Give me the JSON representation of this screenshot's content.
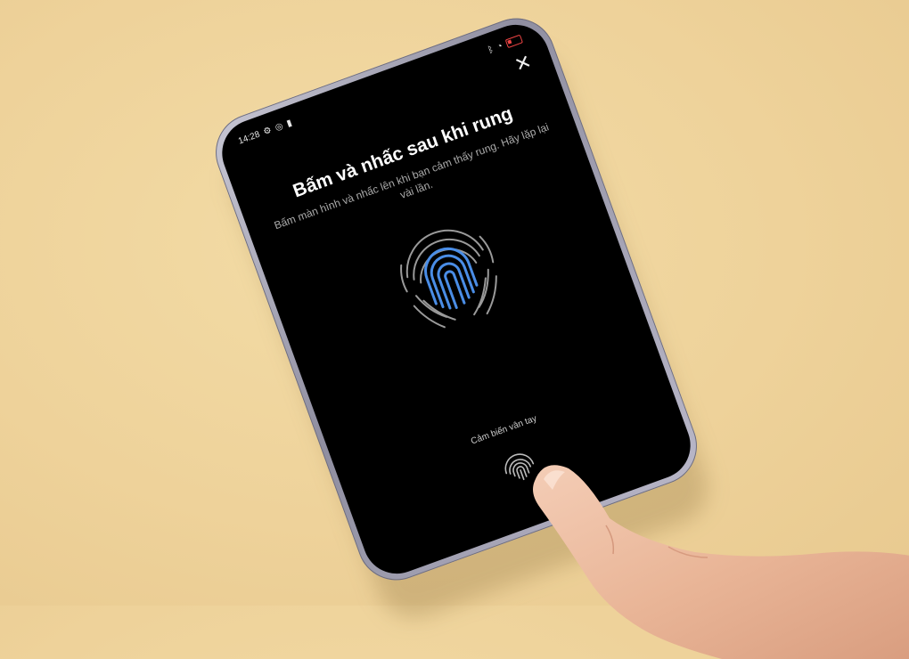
{
  "status_bar": {
    "time": "14:28",
    "left_icons": [
      "gear-icon",
      "location-icon",
      "lock-icon"
    ],
    "right_icons": [
      "bluetooth-icon",
      "wifi-icon",
      "battery-icon"
    ]
  },
  "enroll": {
    "title": "Bấm và nhấc sau khi rung",
    "subtitle": "Bấm màn hình và nhấc lên khi bạn cảm thấy rung. Hãy lặp lại vài lần.",
    "sensor_label": "Cảm biến vân tay",
    "close_icon": "close-icon"
  },
  "colors": {
    "background": "#eed29a",
    "screen": "#000000",
    "fingerprint_idle": "#9a9a9a",
    "fingerprint_progress": "#4a8de6",
    "phone_frame": "#a9a8b8"
  }
}
